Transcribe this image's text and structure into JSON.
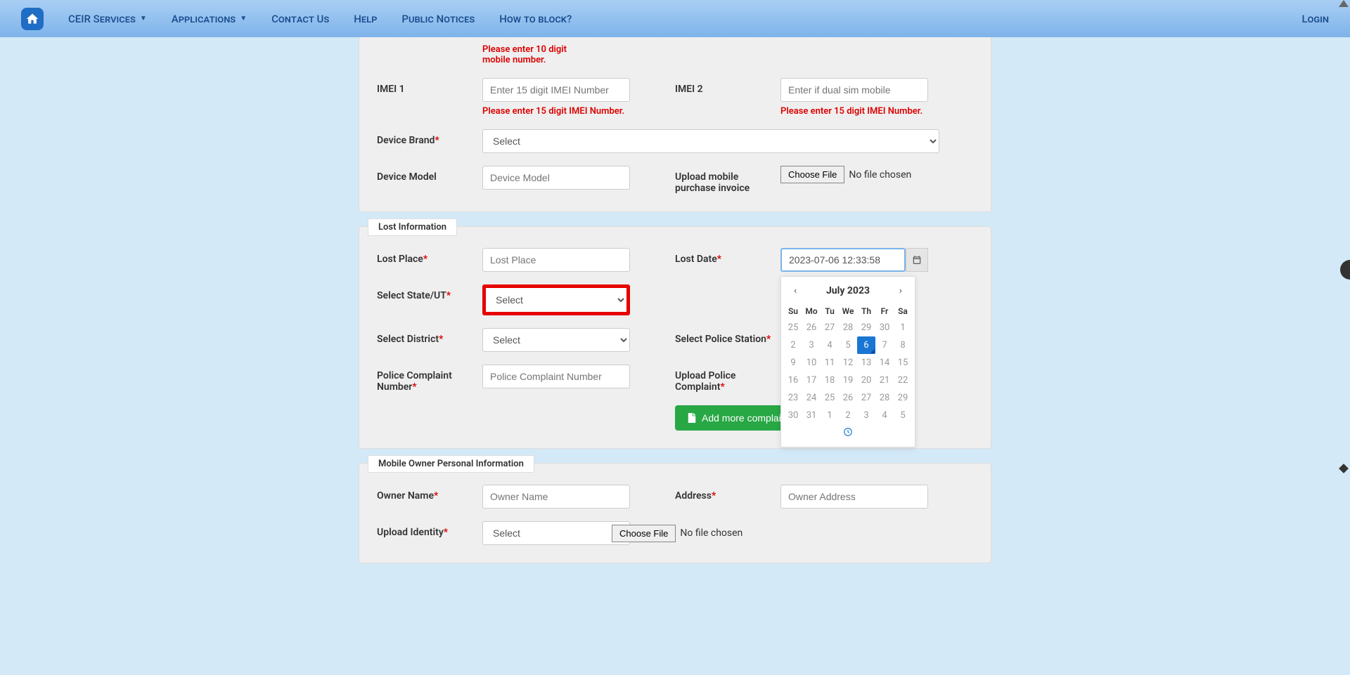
{
  "nav": {
    "items": [
      {
        "label": "CEIR Services",
        "dropdown": true
      },
      {
        "label": "Applications",
        "dropdown": true
      },
      {
        "label": "Contact Us",
        "dropdown": false
      },
      {
        "label": "Help",
        "dropdown": false
      },
      {
        "label": "Public Notices",
        "dropdown": false
      },
      {
        "label": "How to block?",
        "dropdown": false
      }
    ],
    "login": "Login"
  },
  "device_section": {
    "error_mobile": "Please enter 10 digit mobile number.",
    "imei1": {
      "label": "IMEI 1",
      "placeholder": "Enter 15 digit IMEI Number",
      "error": "Please enter 15 digit IMEI Number."
    },
    "imei2": {
      "label": "IMEI 2",
      "placeholder": "Enter if dual sim mobile",
      "error": "Please enter 15 digit IMEI Number."
    },
    "brand": {
      "label": "Device Brand",
      "placeholder": "Select"
    },
    "model": {
      "label": "Device Model",
      "placeholder": "Device Model"
    },
    "invoice": {
      "label": "Upload mobile purchase invoice",
      "btn": "Choose File",
      "text": "No file chosen"
    }
  },
  "lost_section": {
    "legend": "Lost Information",
    "place": {
      "label": "Lost Place",
      "placeholder": "Lost Place"
    },
    "date": {
      "label": "Lost Date",
      "value": "2023-07-06 12:33:58"
    },
    "state": {
      "label": "Select State/UT",
      "placeholder": "Select"
    },
    "district": {
      "label": "Select District",
      "placeholder": "Select"
    },
    "police_station": {
      "label": "Select Police Station"
    },
    "complaint_no": {
      "label": "Police Complaint Number",
      "placeholder": "Police Complaint Number"
    },
    "upload_complaint": {
      "label": "Upload Police Complaint"
    },
    "add_more": "Add more complaint"
  },
  "owner_section": {
    "legend": "Mobile Owner Personal Information",
    "name": {
      "label": "Owner Name",
      "placeholder": "Owner Name"
    },
    "address": {
      "label": "Address",
      "placeholder": "Owner Address"
    },
    "identity": {
      "label": "Upload Identity",
      "placeholder": "Select"
    },
    "identity_file": {
      "btn": "Choose File",
      "text": "No file chosen"
    }
  },
  "datepicker": {
    "title": "July 2023",
    "dow": [
      "Su",
      "Mo",
      "Tu",
      "We",
      "Th",
      "Fr",
      "Sa"
    ],
    "weeks": [
      [
        25,
        26,
        27,
        28,
        29,
        30,
        1
      ],
      [
        2,
        3,
        4,
        5,
        6,
        7,
        8
      ],
      [
        9,
        10,
        11,
        12,
        13,
        14,
        15
      ],
      [
        16,
        17,
        18,
        19,
        20,
        21,
        22
      ],
      [
        23,
        24,
        25,
        26,
        27,
        28,
        29
      ],
      [
        30,
        31,
        1,
        2,
        3,
        4,
        5
      ]
    ],
    "selected": 6
  }
}
